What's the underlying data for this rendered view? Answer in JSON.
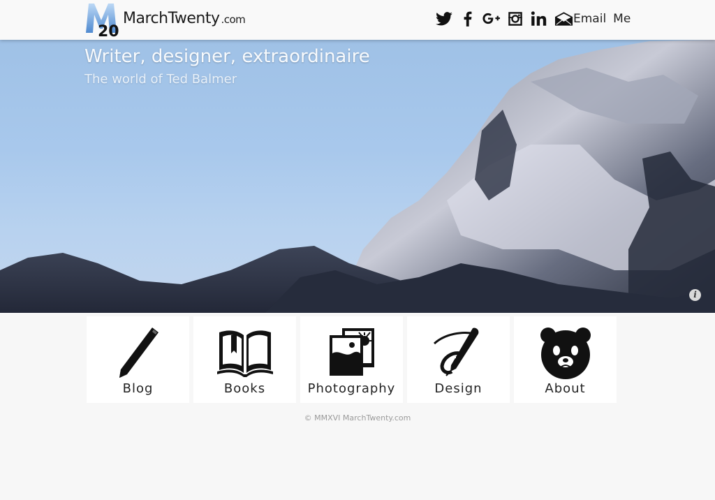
{
  "brand": {
    "logo_number": "20",
    "name": "MarchTwenty",
    "tld": ".com"
  },
  "social": [
    {
      "name": "twitter-icon"
    },
    {
      "name": "facebook-icon"
    },
    {
      "name": "google-plus-icon"
    },
    {
      "name": "instagram-icon"
    },
    {
      "name": "linkedin-icon"
    }
  ],
  "email": {
    "icon": "envelope-icon",
    "word1": "Email",
    "word2": "Me"
  },
  "hero": {
    "title": "Writer, designer, extraordinaire",
    "subtitle": "The world of Ted Balmer",
    "info_glyph": "i"
  },
  "tiles": [
    {
      "label": "Blog",
      "icon": "pencil-icon"
    },
    {
      "label": "Books",
      "icon": "open-book-icon"
    },
    {
      "label": "Photography",
      "icon": "photos-icon"
    },
    {
      "label": "Design",
      "icon": "pen-icon"
    },
    {
      "label": "About",
      "icon": "bear-icon"
    }
  ],
  "footer": {
    "text": "© MMXVI MarchTwenty.com"
  },
  "colors": {
    "sky": "#a8c8ec",
    "header_bg": "#f9f9f9",
    "page_bg": "#f7f7f7",
    "tile_bg": "#ffffff"
  }
}
